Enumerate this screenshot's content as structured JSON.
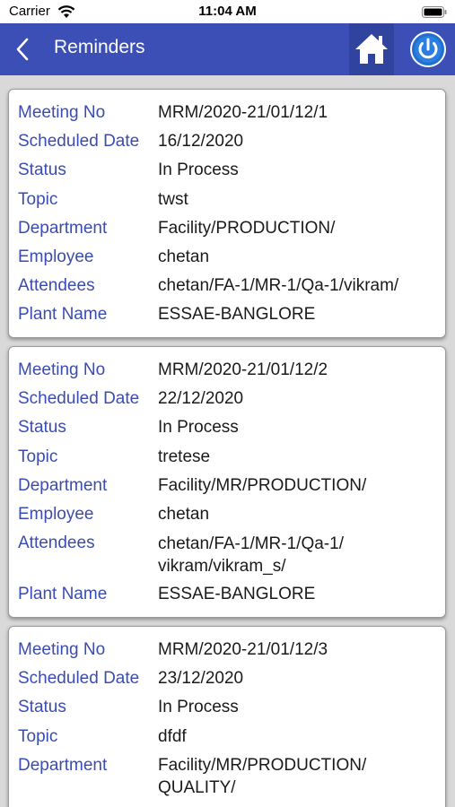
{
  "status_bar": {
    "carrier": "Carrier",
    "time": "11:04 AM",
    "wifi_icon": "wifi-icon",
    "battery_icon": "battery-icon"
  },
  "nav": {
    "title": "Reminders",
    "back_icon": "chevron-left-icon",
    "home_icon": "home-icon",
    "power_icon": "power-icon",
    "bar_color": "#3c4fb6"
  },
  "labels": {
    "meeting_no": "Meeting No",
    "scheduled_date": "Scheduled Date",
    "status": "Status",
    "topic": "Topic",
    "department": "Department",
    "employee": "Employee",
    "attendees": "Attendees",
    "plant_name": "Plant Name"
  },
  "reminders": [
    {
      "meeting_no": "MRM/2020-21/01/12/1",
      "scheduled_date": "16/12/2020",
      "status": "In Process",
      "topic": "twst",
      "department": "Facility/PRODUCTION/",
      "employee": "chetan",
      "attendees": "chetan/FA-1/MR-1/Qa-1/vikram/",
      "plant_name": "ESSAE-BANGLORE"
    },
    {
      "meeting_no": "MRM/2020-21/01/12/2",
      "scheduled_date": "22/12/2020",
      "status": "In Process",
      "topic": "tretese",
      "department": "Facility/MR/PRODUCTION/",
      "employee": "chetan",
      "attendees": "chetan/FA-1/MR-1/Qa-1/ vikram/vikram_s/",
      "plant_name": "ESSAE-BANGLORE"
    },
    {
      "meeting_no": "MRM/2020-21/01/12/3",
      "scheduled_date": "23/12/2020",
      "status": "In Process",
      "topic": "dfdf",
      "department": "Facility/MR/PRODUCTION/ QUALITY/"
    }
  ]
}
